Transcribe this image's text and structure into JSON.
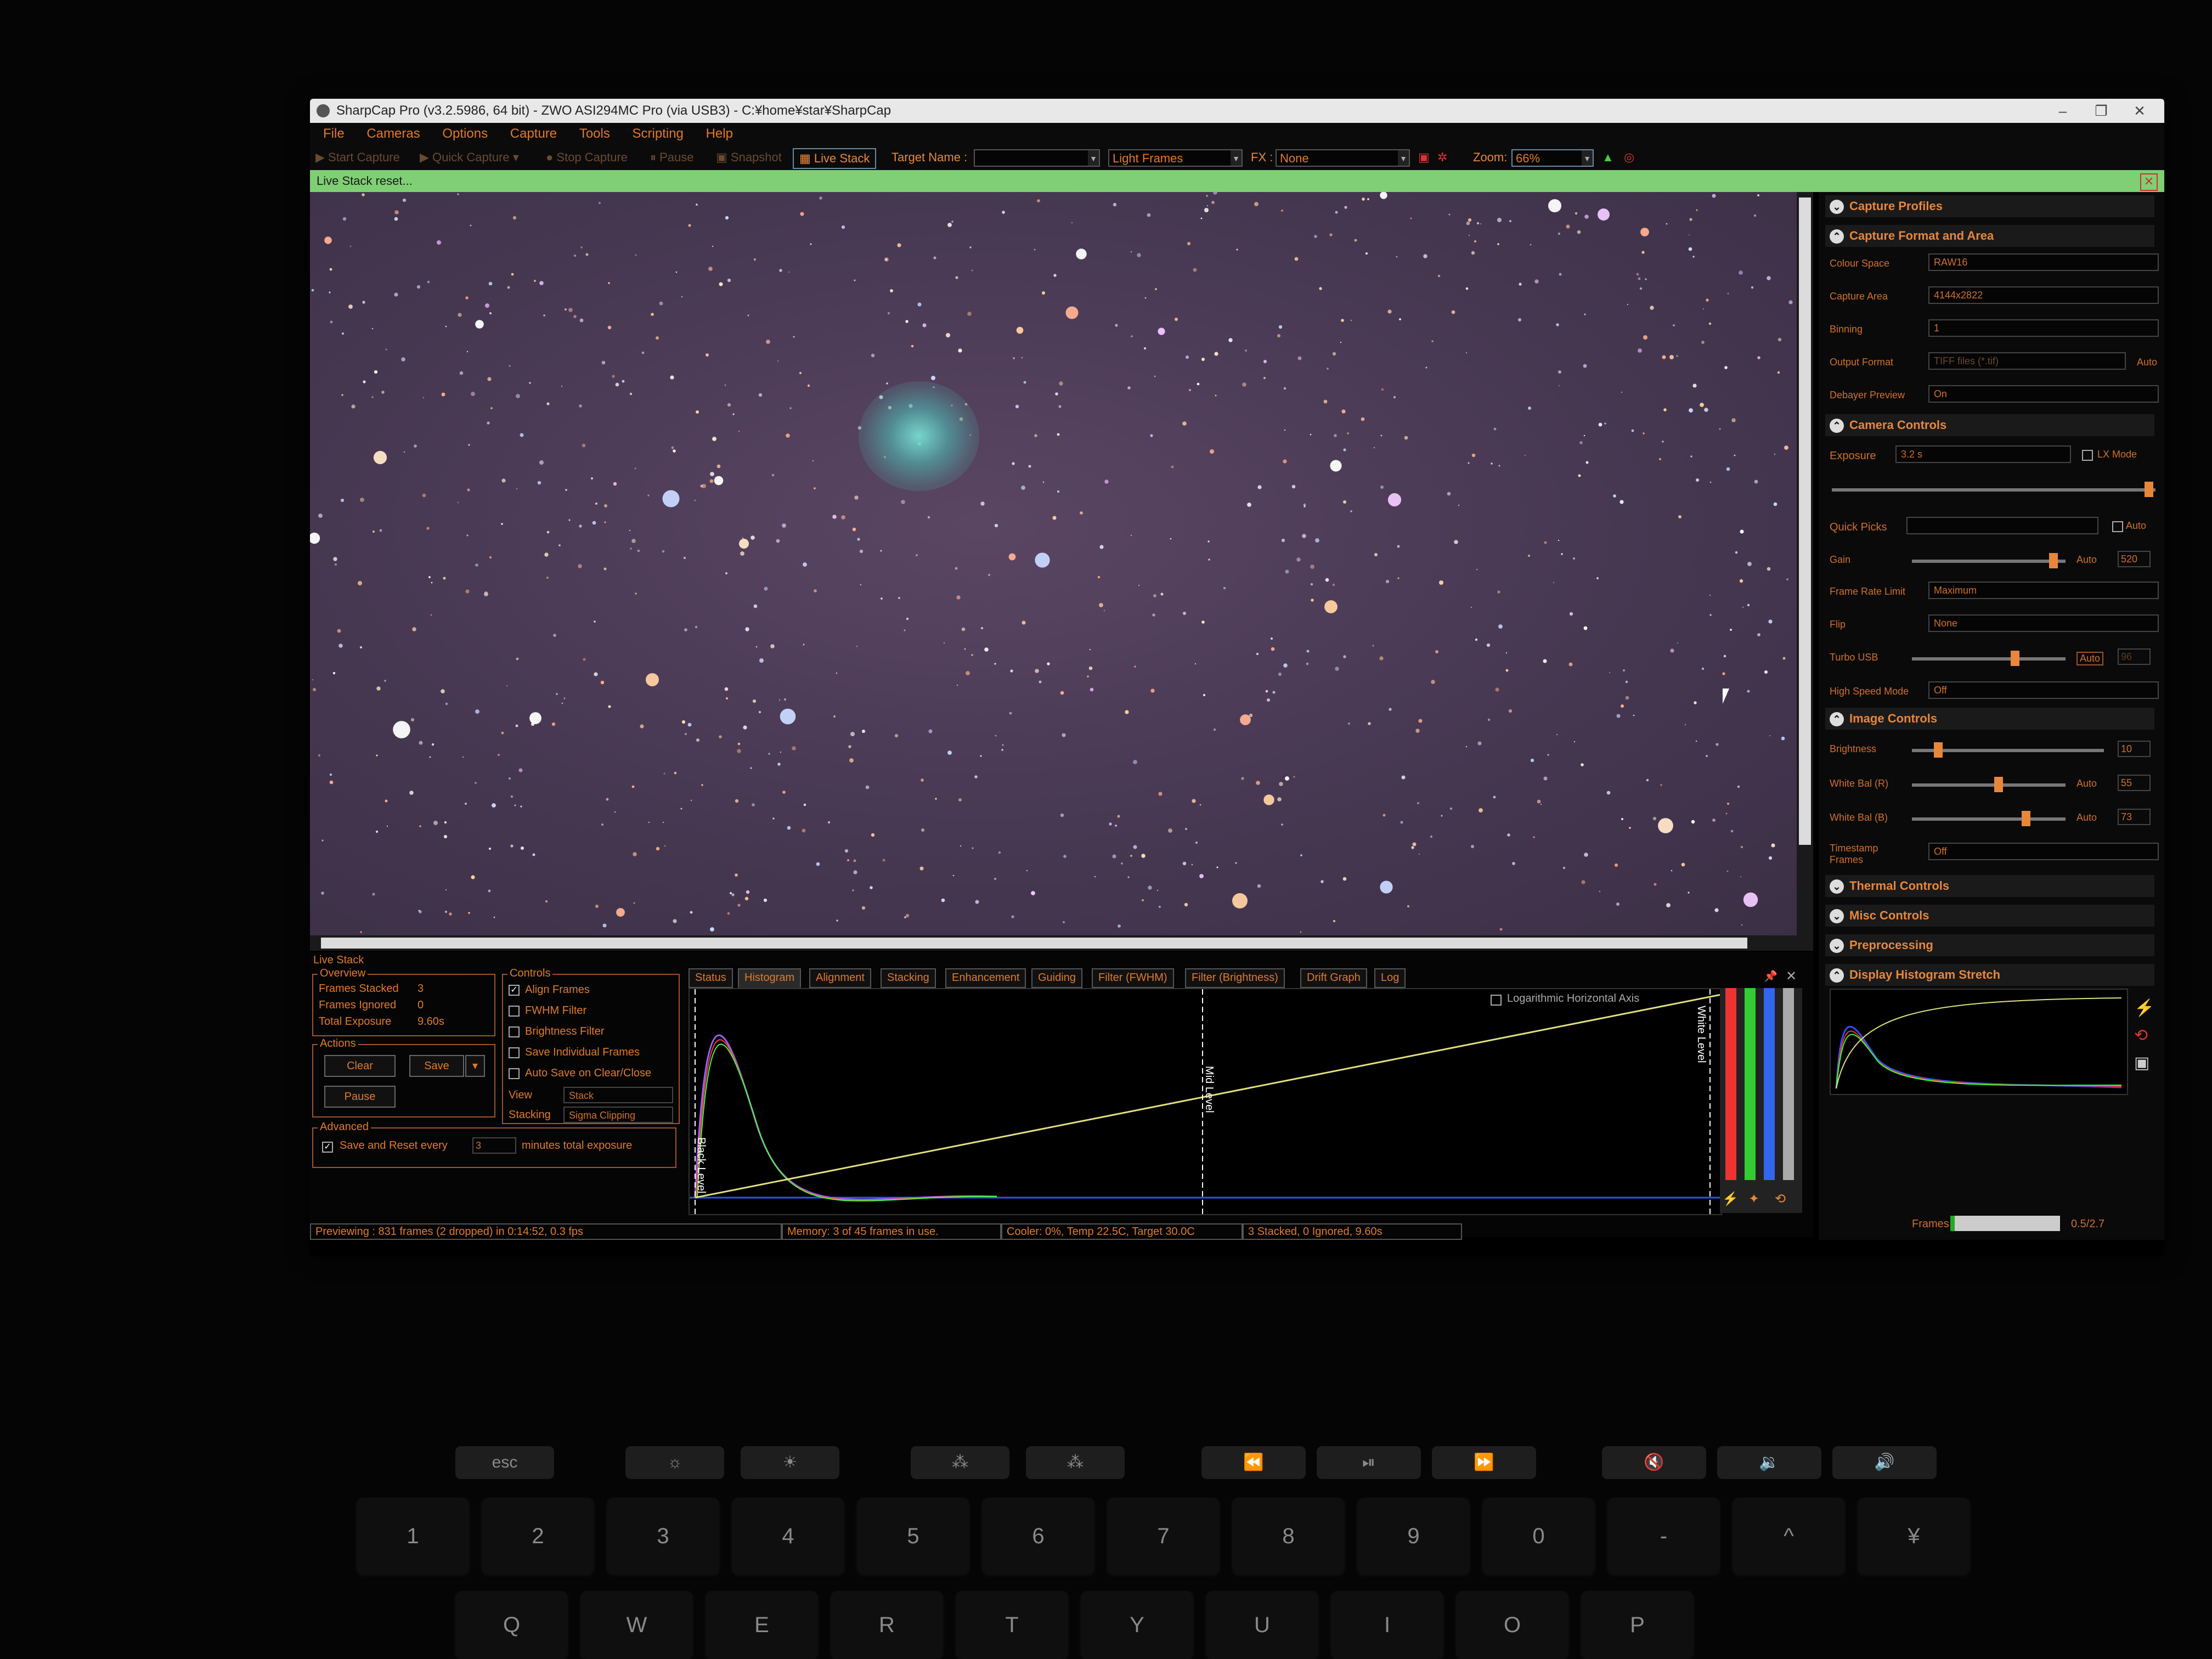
{
  "window": {
    "title": "SharpCap Pro (v3.2.5986, 64 bit) - ZWO ASI294MC Pro (via USB3) - C:¥home¥star¥SharpCap",
    "minimize": "–",
    "restore": "❐",
    "close": "✕"
  },
  "menu": [
    "File",
    "Cameras",
    "Options",
    "Capture",
    "Tools",
    "Scripting",
    "Help"
  ],
  "toolbar": {
    "start_capture": "Start Capture",
    "quick_capture": "Quick Capture",
    "stop_capture": "Stop Capture",
    "pause": "Pause",
    "snapshot": "Snapshot",
    "live_stack": "Live Stack",
    "target_name_label": "Target Name :",
    "target_name_value": "",
    "frame_type": "Light Frames",
    "fx_label": "FX :",
    "fx_value": "None",
    "zoom_label": "Zoom:",
    "zoom_value": "66%"
  },
  "notification": {
    "text": "Live Stack reset...",
    "close": "✕"
  },
  "right_panel": {
    "capture_profiles": "Capture Profiles",
    "capture_format": {
      "header": "Capture Format and Area",
      "colour_space_label": "Colour Space",
      "colour_space": "RAW16",
      "capture_area_label": "Capture Area",
      "capture_area": "4144x2822",
      "binning_label": "Binning",
      "binning": "1",
      "output_format_label": "Output Format",
      "output_format": "TIFF files (*.tif)",
      "output_auto": "Auto",
      "debayer_label": "Debayer Preview",
      "debayer": "On"
    },
    "camera_controls": {
      "header": "Camera Controls",
      "exposure_label": "Exposure",
      "exposure": "3.2 s",
      "lx_mode": "LX Mode",
      "quick_picks_label": "Quick Picks",
      "quick_picks_auto": "Auto",
      "gain_label": "Gain",
      "gain_auto": "Auto",
      "gain_value": "520",
      "frame_rate_label": "Frame Rate Limit",
      "frame_rate": "Maximum",
      "flip_label": "Flip",
      "flip": "None",
      "turbo_label": "Turbo USB",
      "turbo_auto": "Auto",
      "turbo_value": "96",
      "highspeed_label": "High Speed Mode",
      "highspeed": "Off"
    },
    "image_controls": {
      "header": "Image Controls",
      "brightness_label": "Brightness",
      "brightness_value": "10",
      "wb_r_label": "White Bal (R)",
      "wb_r_auto": "Auto",
      "wb_r_value": "55",
      "wb_b_label": "White Bal (B)",
      "wb_b_auto": "Auto",
      "wb_b_value": "73",
      "timestamp_label": "Timestamp Frames",
      "timestamp": "Off"
    },
    "thermal": "Thermal Controls",
    "misc": "Misc Controls",
    "preprocessing": "Preprocessing",
    "histogram_stretch": "Display Histogram Stretch",
    "frames_label": "Frames",
    "frames_value": "0.5/2.7"
  },
  "live_stack": {
    "title": "Live Stack",
    "overview": {
      "title": "Overview",
      "frames_stacked_label": "Frames Stacked",
      "frames_stacked": "3",
      "frames_ignored_label": "Frames Ignored",
      "frames_ignored": "0",
      "total_exposure_label": "Total Exposure",
      "total_exposure": "9.60s"
    },
    "actions": {
      "title": "Actions",
      "clear": "Clear",
      "save": "Save",
      "pause": "Pause"
    },
    "advanced": {
      "title": "Advanced",
      "save_reset": "Save and Reset every",
      "minutes": "3",
      "minutes_label": "minutes total exposure"
    },
    "controls": {
      "title": "Controls",
      "align": "Align Frames",
      "fwhm": "FWHM Filter",
      "brightness": "Brightness Filter",
      "save_individual": "Save Individual Frames",
      "auto_save": "Auto Save on Clear/Close",
      "view_label": "View",
      "view": "Stack",
      "stacking_label": "Stacking",
      "stacking": "Sigma Clipping"
    },
    "tabs": [
      "Status",
      "Histogram",
      "Alignment",
      "Stacking",
      "Enhancement",
      "Guiding",
      "Filter (FWHM)",
      "Filter (Brightness)",
      "Drift Graph",
      "Log"
    ],
    "histogram": {
      "log_axis": "Logarithmic Horizontal Axis",
      "black_level": "Black Level",
      "mid_level": "Mid Level",
      "white_level": "White Level"
    }
  },
  "status_bar": {
    "preview": "Previewing : 831 frames (2 dropped) in 0:14:52, 0.3 fps",
    "memory": "Memory: 3 of 45 frames in use.",
    "cooler": "Cooler: 0%, Temp 22.5C, Target 30.0C",
    "stack": "3 Stacked, 0 Ignored, 9.60s"
  },
  "keyboard": {
    "esc": "esc",
    "numbers": [
      "1",
      "2",
      "3",
      "4",
      "5",
      "6",
      "7",
      "8",
      "9",
      "0",
      "-",
      "^",
      "¥"
    ],
    "letters": [
      "Q",
      "W",
      "E",
      "R",
      "T",
      "Y",
      "U",
      "I",
      "O",
      "P"
    ]
  }
}
